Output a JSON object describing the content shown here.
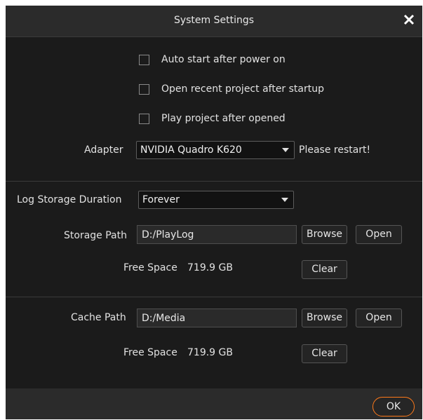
{
  "dialog": {
    "title": "System Settings"
  },
  "icons": {
    "close": "close-icon",
    "dropdown": "chevron-down-icon"
  },
  "options": {
    "auto_start": {
      "label": "Auto start after power on",
      "checked": false
    },
    "open_recent": {
      "label": "Open recent project after startup",
      "checked": false
    },
    "play_after_open": {
      "label": "Play project after opened",
      "checked": false
    }
  },
  "adapter": {
    "label": "Adapter",
    "value": "NVIDIA Quadro K620",
    "note": "Please restart!"
  },
  "log": {
    "duration_label": "Log Storage Duration",
    "duration_value": "Forever",
    "path_label": "Storage Path",
    "path_value": "D:/PlayLog",
    "browse_label": "Browse",
    "open_label": "Open",
    "free_space_label": "Free Space",
    "free_space_value": "719.9 GB",
    "clear_label": "Clear"
  },
  "cache": {
    "path_label": "Cache Path",
    "path_value": "D:/Media",
    "browse_label": "Browse",
    "open_label": "Open",
    "free_space_label": "Free Space",
    "free_space_value": "719.9 GB",
    "clear_label": "Clear"
  },
  "footer": {
    "ok_label": "OK"
  },
  "colors": {
    "accent": "#ff7a1a",
    "background": "#1b1b1b",
    "titlebar": "#2b2b2b"
  }
}
